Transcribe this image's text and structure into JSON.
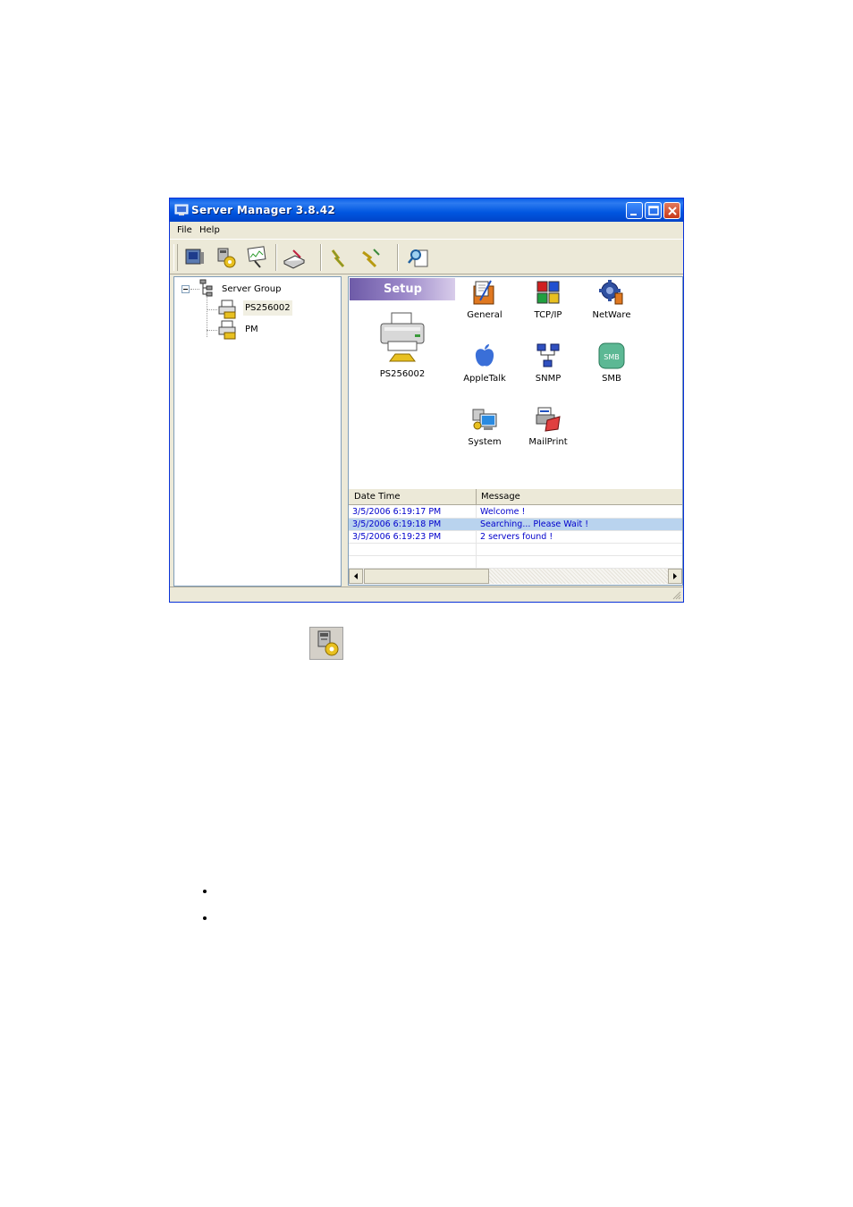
{
  "window": {
    "title": "Server Manager 3.8.42",
    "menu": [
      "File",
      "Help"
    ],
    "toolbar_icons": [
      "server-view-icon",
      "server-setup-icon",
      "search-server-icon",
      "print-test-icon",
      "connect-icon",
      "disconnect-icon",
      "zoom-icon"
    ]
  },
  "tree": {
    "root": "Server Group",
    "children": [
      "PS256002",
      "PM"
    ],
    "selected": "PS256002"
  },
  "setup": {
    "header": "Setup",
    "device": "PS256002",
    "features": [
      "General",
      "TCP/IP",
      "NetWare",
      "AppleTalk",
      "SNMP",
      "SMB",
      "System",
      "MailPrint"
    ],
    "smb_badge": "SMB"
  },
  "log": {
    "columns": [
      "Date Time",
      "Message"
    ],
    "rows": [
      {
        "time": "3/5/2006 6:19:17 PM",
        "message": "Welcome !"
      },
      {
        "time": "3/5/2006 6:19:18 PM",
        "message": "Searching... Please Wait !"
      },
      {
        "time": "3/5/2006 6:19:23 PM",
        "message": "2 servers found !"
      }
    ],
    "selected_row": 1
  },
  "colors": {
    "titlebar": "#0A5FE8",
    "log_text": "#0000CC",
    "selected_row": "#B9D3EE",
    "setup_header": "#9A87C8"
  }
}
